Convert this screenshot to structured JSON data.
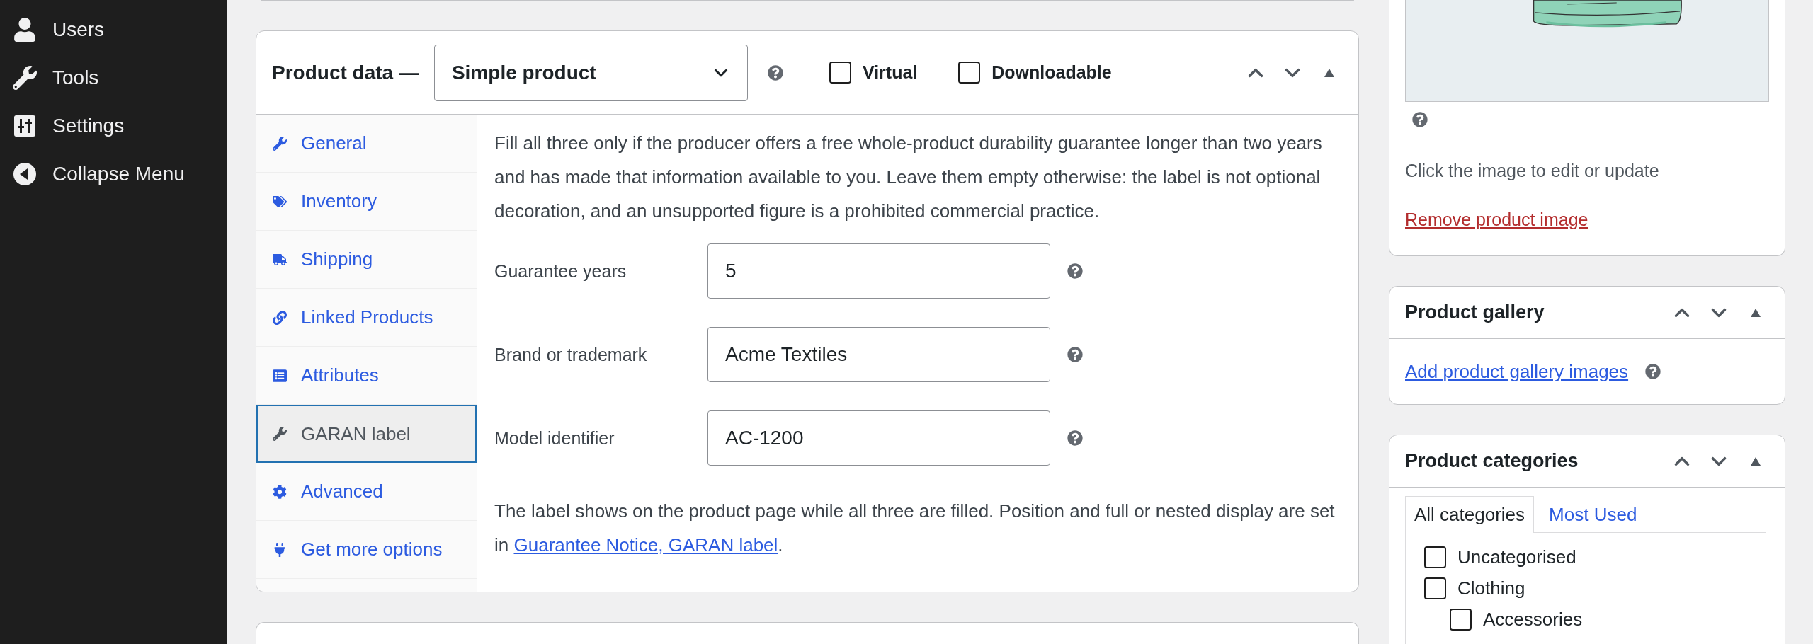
{
  "admin_menu": [
    {
      "label": "Users"
    },
    {
      "label": "Tools"
    },
    {
      "label": "Settings"
    },
    {
      "label": "Collapse Menu"
    }
  ],
  "product_data": {
    "title": "Product data —",
    "product_type": "Simple product",
    "options": [
      {
        "label": "Virtual",
        "checked": false
      },
      {
        "label": "Downloadable",
        "checked": false
      }
    ],
    "tabs": [
      {
        "label": "General",
        "selected": false
      },
      {
        "label": "Inventory",
        "selected": false
      },
      {
        "label": "Shipping",
        "selected": false
      },
      {
        "label": "Linked Products",
        "selected": false
      },
      {
        "label": "Attributes",
        "selected": false
      },
      {
        "label": "GARAN label",
        "selected": true
      },
      {
        "label": "Advanced",
        "selected": false
      },
      {
        "label": "Get more options",
        "selected": false
      }
    ],
    "intro": "Fill all three only if the producer offers a free whole-product durability guarantee longer than two years and has made that information available to you. Leave them empty otherwise: the label is not optional decoration, and an unsupported figure is a prohibited commercial practice.",
    "fields": [
      {
        "label": "Guarantee years",
        "value": "5"
      },
      {
        "label": "Brand or trademark",
        "value": "Acme Textiles"
      },
      {
        "label": "Model identifier",
        "value": "AC-1200"
      }
    ],
    "note": "The label shows on the product page while all three are filled. Position and full or nested display are set in",
    "note_link": "Guarantee Notice, GARAN label",
    "note_end": "."
  },
  "product_image": {
    "hint": "Click the image to edit or update",
    "remove_link": "Remove product image"
  },
  "product_gallery": {
    "title": "Product gallery",
    "add_link": "Add product gallery images"
  },
  "product_categories": {
    "title": "Product categories",
    "tabs": [
      {
        "label": "All categories",
        "selected": true
      },
      {
        "label": "Most Used",
        "selected": false
      }
    ],
    "categories": [
      {
        "label": "Uncategorised",
        "checked": false
      },
      {
        "label": "Clothing",
        "checked": false,
        "children": [
          {
            "label": "Accessories",
            "checked": false
          }
        ]
      }
    ]
  }
}
